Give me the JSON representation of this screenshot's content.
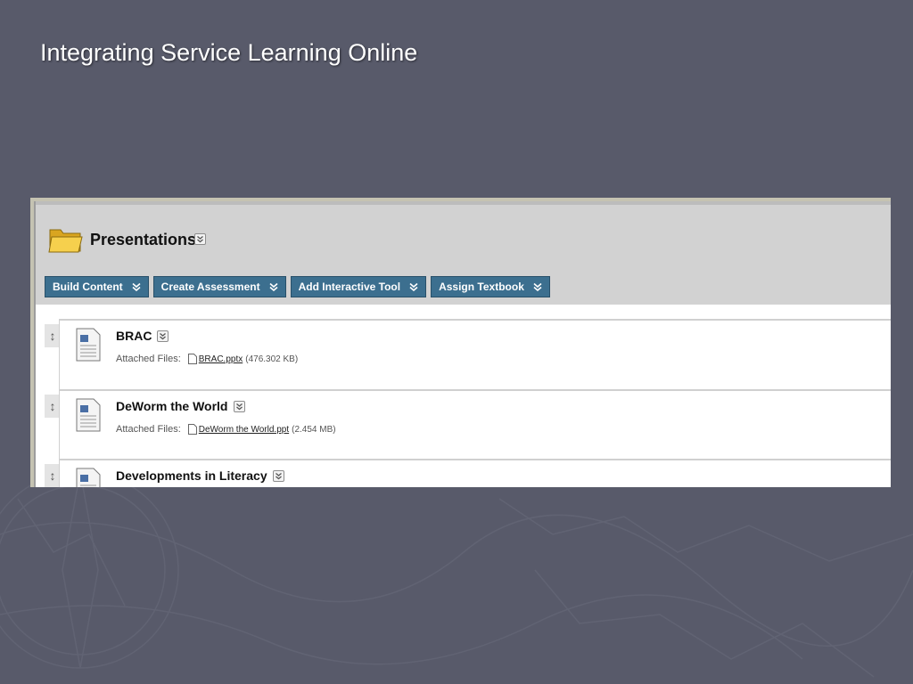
{
  "slide": {
    "title": "Integrating Service Learning Online"
  },
  "page": {
    "title": "Presentations",
    "icons": {
      "folder": "folder-icon",
      "menu": "chevron-down-icon"
    }
  },
  "toolbar": {
    "buttons": [
      {
        "label": "Build Content"
      },
      {
        "label": "Create Assessment"
      },
      {
        "label": "Add Interactive Tool"
      },
      {
        "label": "Assign Textbook"
      }
    ]
  },
  "items": [
    {
      "title": "BRAC",
      "attached_label": "Attached Files:",
      "file_name": " BRAC.pptx",
      "file_size": "(476.302 KB)"
    },
    {
      "title": "DeWorm the World",
      "attached_label": "Attached Files:",
      "file_name": " DeWorm the World.ppt",
      "file_size": "(2.454 MB)"
    },
    {
      "title": "Developments in Literacy"
    }
  ],
  "colors": {
    "background": "#585a6a",
    "toolbar_button": "#3c6f8f",
    "header_bar": "#d2d2d2"
  }
}
